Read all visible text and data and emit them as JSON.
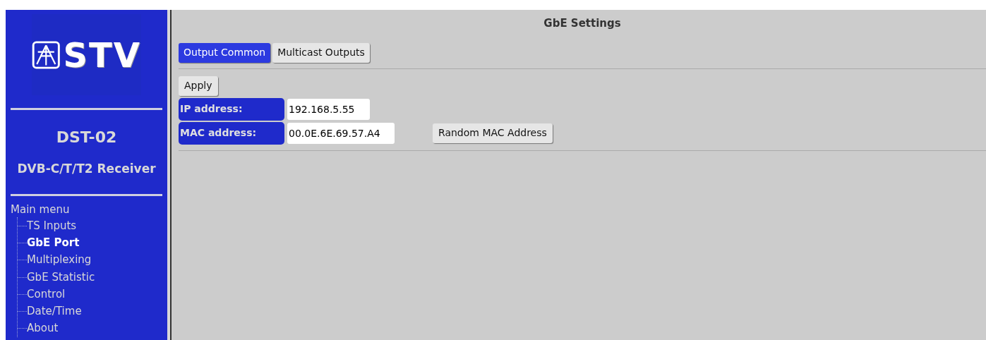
{
  "sidebar": {
    "logo_text": "STV",
    "device": "DST-02",
    "subtitle": "DVB-C/T/T2 Receiver",
    "menu_title": "Main menu",
    "items": [
      {
        "label": "TS Inputs",
        "selected": false
      },
      {
        "label": "GbE Port",
        "selected": true
      },
      {
        "label": "Multiplexing",
        "selected": false
      },
      {
        "label": "GbE Statistic",
        "selected": false
      },
      {
        "label": "Control",
        "selected": false
      },
      {
        "label": "Date/Time",
        "selected": false
      },
      {
        "label": "About",
        "selected": false
      }
    ]
  },
  "main": {
    "title": "GbE Settings",
    "tabs": [
      {
        "label": "Output Common",
        "selected": true
      },
      {
        "label": "Multicast Outputs",
        "selected": false
      }
    ],
    "apply": "Apply",
    "fields": [
      {
        "label": "IP address:",
        "value": "192.168.5.55"
      },
      {
        "label": "MAC address:",
        "value": "00.0E.6E.69.57.A4",
        "button": "Random MAC Address"
      }
    ]
  }
}
